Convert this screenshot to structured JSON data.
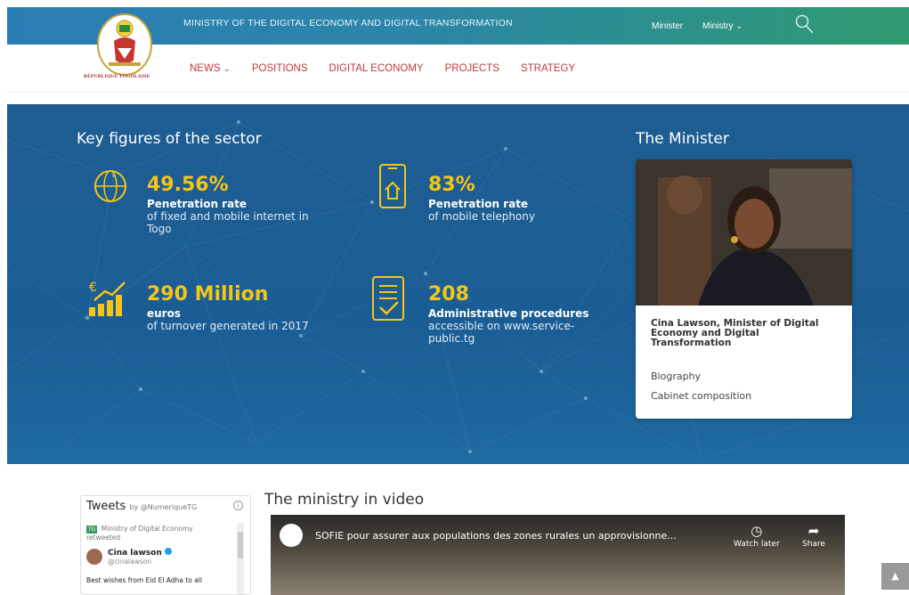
{
  "header": {
    "title": "MINISTRY OF THE DIGITAL ECONOMY AND DIGITAL TRANSFORMATION",
    "top_links": [
      "Minister",
      "Ministry"
    ],
    "logo_text": "RÉPUBLIQUE TOGOLAISE",
    "nav": [
      "NEWS",
      "POSITIONS",
      "DIGITAL ECONOMY",
      "PROJECTS",
      "STRATEGY"
    ]
  },
  "hero": {
    "title": "Key figures of the sector",
    "figures": [
      {
        "value": "49.56%",
        "label": "Penetration rate",
        "sub": "of fixed and mobile internet in Togo",
        "icon": "globe-icon"
      },
      {
        "value": "83%",
        "label": "Penetration rate",
        "sub": "of mobile telephony",
        "icon": "mobile-icon"
      },
      {
        "value": "290 Million",
        "label": "euros",
        "sub": "of turnover generated in 2017",
        "icon": "euro-chart-icon"
      },
      {
        "value": "208",
        "label": "Administrative procedures",
        "sub": "accessible on www.service-public.tg",
        "icon": "checklist-icon"
      }
    ],
    "accent_color": "#f5c518"
  },
  "minister": {
    "section_title": "The Minister",
    "name": "Cina Lawson, Minister of Digital Economy and Digital Transformation",
    "links": [
      "Biography",
      "Cabinet composition"
    ]
  },
  "tweets": {
    "title": "Tweets",
    "by": "by @NumeriqueTG",
    "retweeted": "Ministry of Digital Economy",
    "retweeted_suffix": "retweeted",
    "user": "Cina lawson",
    "handle": "@cinalawson",
    "text": "Best wishes from Eid El Adha to all"
  },
  "video": {
    "section_title": "The ministry in video",
    "title": "SOFIE pour assurer aux populations des zones rurales un approvisionne...",
    "actions": [
      "Watch later",
      "Share"
    ]
  }
}
